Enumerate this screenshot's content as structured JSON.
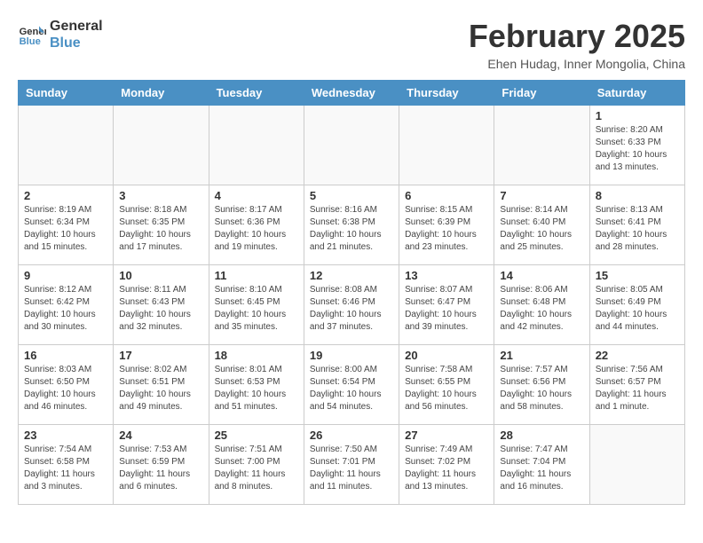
{
  "logo": {
    "line1": "General",
    "line2": "Blue"
  },
  "title": "February 2025",
  "subtitle": "Ehen Hudag, Inner Mongolia, China",
  "days_of_week": [
    "Sunday",
    "Monday",
    "Tuesday",
    "Wednesday",
    "Thursday",
    "Friday",
    "Saturday"
  ],
  "weeks": [
    [
      {
        "day": "",
        "info": ""
      },
      {
        "day": "",
        "info": ""
      },
      {
        "day": "",
        "info": ""
      },
      {
        "day": "",
        "info": ""
      },
      {
        "day": "",
        "info": ""
      },
      {
        "day": "",
        "info": ""
      },
      {
        "day": "1",
        "info": "Sunrise: 8:20 AM\nSunset: 6:33 PM\nDaylight: 10 hours\nand 13 minutes."
      }
    ],
    [
      {
        "day": "2",
        "info": "Sunrise: 8:19 AM\nSunset: 6:34 PM\nDaylight: 10 hours\nand 15 minutes."
      },
      {
        "day": "3",
        "info": "Sunrise: 8:18 AM\nSunset: 6:35 PM\nDaylight: 10 hours\nand 17 minutes."
      },
      {
        "day": "4",
        "info": "Sunrise: 8:17 AM\nSunset: 6:36 PM\nDaylight: 10 hours\nand 19 minutes."
      },
      {
        "day": "5",
        "info": "Sunrise: 8:16 AM\nSunset: 6:38 PM\nDaylight: 10 hours\nand 21 minutes."
      },
      {
        "day": "6",
        "info": "Sunrise: 8:15 AM\nSunset: 6:39 PM\nDaylight: 10 hours\nand 23 minutes."
      },
      {
        "day": "7",
        "info": "Sunrise: 8:14 AM\nSunset: 6:40 PM\nDaylight: 10 hours\nand 25 minutes."
      },
      {
        "day": "8",
        "info": "Sunrise: 8:13 AM\nSunset: 6:41 PM\nDaylight: 10 hours\nand 28 minutes."
      }
    ],
    [
      {
        "day": "9",
        "info": "Sunrise: 8:12 AM\nSunset: 6:42 PM\nDaylight: 10 hours\nand 30 minutes."
      },
      {
        "day": "10",
        "info": "Sunrise: 8:11 AM\nSunset: 6:43 PM\nDaylight: 10 hours\nand 32 minutes."
      },
      {
        "day": "11",
        "info": "Sunrise: 8:10 AM\nSunset: 6:45 PM\nDaylight: 10 hours\nand 35 minutes."
      },
      {
        "day": "12",
        "info": "Sunrise: 8:08 AM\nSunset: 6:46 PM\nDaylight: 10 hours\nand 37 minutes."
      },
      {
        "day": "13",
        "info": "Sunrise: 8:07 AM\nSunset: 6:47 PM\nDaylight: 10 hours\nand 39 minutes."
      },
      {
        "day": "14",
        "info": "Sunrise: 8:06 AM\nSunset: 6:48 PM\nDaylight: 10 hours\nand 42 minutes."
      },
      {
        "day": "15",
        "info": "Sunrise: 8:05 AM\nSunset: 6:49 PM\nDaylight: 10 hours\nand 44 minutes."
      }
    ],
    [
      {
        "day": "16",
        "info": "Sunrise: 8:03 AM\nSunset: 6:50 PM\nDaylight: 10 hours\nand 46 minutes."
      },
      {
        "day": "17",
        "info": "Sunrise: 8:02 AM\nSunset: 6:51 PM\nDaylight: 10 hours\nand 49 minutes."
      },
      {
        "day": "18",
        "info": "Sunrise: 8:01 AM\nSunset: 6:53 PM\nDaylight: 10 hours\nand 51 minutes."
      },
      {
        "day": "19",
        "info": "Sunrise: 8:00 AM\nSunset: 6:54 PM\nDaylight: 10 hours\nand 54 minutes."
      },
      {
        "day": "20",
        "info": "Sunrise: 7:58 AM\nSunset: 6:55 PM\nDaylight: 10 hours\nand 56 minutes."
      },
      {
        "day": "21",
        "info": "Sunrise: 7:57 AM\nSunset: 6:56 PM\nDaylight: 10 hours\nand 58 minutes."
      },
      {
        "day": "22",
        "info": "Sunrise: 7:56 AM\nSunset: 6:57 PM\nDaylight: 11 hours\nand 1 minute."
      }
    ],
    [
      {
        "day": "23",
        "info": "Sunrise: 7:54 AM\nSunset: 6:58 PM\nDaylight: 11 hours\nand 3 minutes."
      },
      {
        "day": "24",
        "info": "Sunrise: 7:53 AM\nSunset: 6:59 PM\nDaylight: 11 hours\nand 6 minutes."
      },
      {
        "day": "25",
        "info": "Sunrise: 7:51 AM\nSunset: 7:00 PM\nDaylight: 11 hours\nand 8 minutes."
      },
      {
        "day": "26",
        "info": "Sunrise: 7:50 AM\nSunset: 7:01 PM\nDaylight: 11 hours\nand 11 minutes."
      },
      {
        "day": "27",
        "info": "Sunrise: 7:49 AM\nSunset: 7:02 PM\nDaylight: 11 hours\nand 13 minutes."
      },
      {
        "day": "28",
        "info": "Sunrise: 7:47 AM\nSunset: 7:04 PM\nDaylight: 11 hours\nand 16 minutes."
      },
      {
        "day": "",
        "info": ""
      }
    ]
  ]
}
